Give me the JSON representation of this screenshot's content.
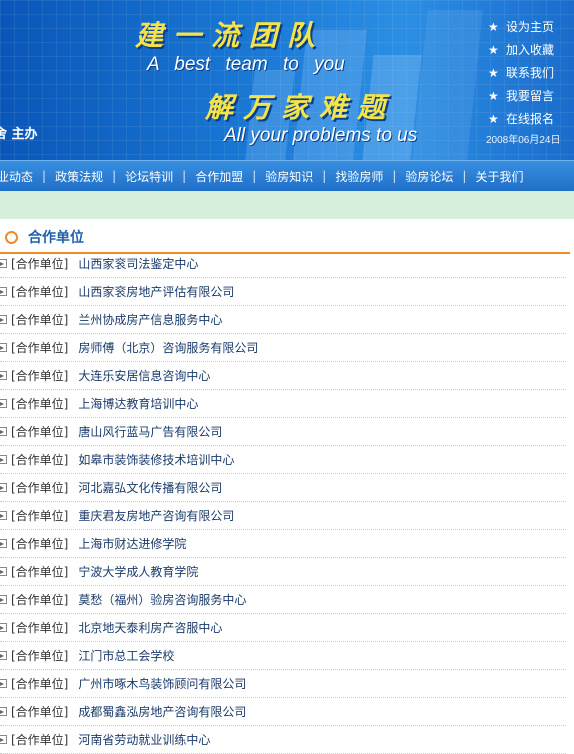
{
  "banner": {
    "slogan_cn_1": "建一流团队",
    "slogan_en_1": "A best team to you",
    "slogan_cn_2": "解万家难题",
    "slogan_en_2": "All your problems to us",
    "sponsor": "舍 主办",
    "date": "2008年06月24日",
    "quick_links": [
      {
        "label": "设为主页",
        "icon": "star-icon"
      },
      {
        "label": "加入收藏",
        "icon": "star-icon"
      },
      {
        "label": "联系我们",
        "icon": "star-icon"
      },
      {
        "label": "我要留言",
        "icon": "star-icon"
      },
      {
        "label": "在线报名",
        "icon": "star-icon"
      }
    ]
  },
  "nav": {
    "items": [
      "业动态",
      "政策法规",
      "论坛特训",
      "合作加盟",
      "验房知识",
      "找验房师",
      "验房论坛",
      "关于我们"
    ]
  },
  "section": {
    "title": "合作单位",
    "icon": "circle-bullet-icon",
    "item_tag": "[合作单位]",
    "items": [
      "山西家衮司法鉴定中心",
      "山西家衮房地产评估有限公司",
      "兰州协成房产信息服务中心",
      "房师傅（北京）咨询服务有限公司",
      "大连乐安居信息咨询中心",
      "上海博达教育培训中心",
      "唐山风行蓝马广告有限公司",
      "如皋市装饰装修技术培训中心",
      "河北嘉弘文化传播有限公司",
      "重庆君友房地产咨询有限公司",
      "上海市财达进修学院",
      "宁波大学成人教育学院",
      "莫愁（福州）验房咨询服务中心",
      "北京地天泰利房产咨服中心",
      "江门市总工会学校",
      "广州市啄木鸟装饰顾问有限公司",
      "成都蜀鑫泓房地产咨询有限公司",
      "河南省劳动就业训练中心"
    ]
  }
}
